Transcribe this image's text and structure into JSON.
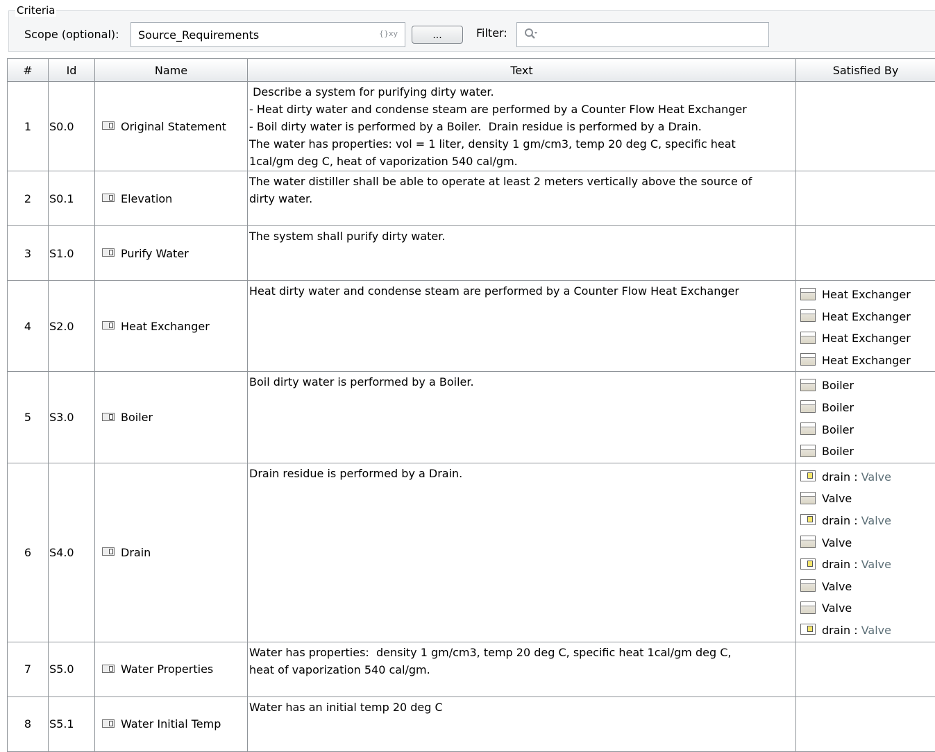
{
  "criteria": {
    "title": "Criteria",
    "scope_label": "Scope (optional):",
    "scope_value": "Source_Requirements",
    "scope_icon": "{}xy",
    "browse_label": "...",
    "filter_label": "Filter:"
  },
  "table": {
    "headers": {
      "num": "#",
      "id": "Id",
      "name": "Name",
      "text": "Text",
      "satisfied": "Satisfied By"
    },
    "rows": [
      {
        "num": "1",
        "id": "S0.0",
        "name": "Original Statement",
        "text_lines": [
          " Describe a system for purifying dirty water.",
          "- Heat dirty water and condense steam are performed by a Counter Flow Heat Exchanger",
          "- Boil dirty water is performed by a Boiler.  Drain residue is performed by a Drain.",
          "The water has properties: vol = 1 liter, density 1 gm/cm3, temp 20 deg C, specific heat",
          "1cal/gm deg C, heat of vaporization 540 cal/gm."
        ]
      },
      {
        "num": "2",
        "id": "S0.1",
        "name": "Elevation",
        "text_lines": [
          "The water distiller shall be able to operate at least 2 meters vertically above the source of",
          "dirty water."
        ]
      },
      {
        "num": "3",
        "id": "S1.0",
        "name": "Purify Water",
        "text_lines": [
          "The system shall purify dirty water."
        ]
      },
      {
        "num": "4",
        "id": "S2.0",
        "name": "Heat Exchanger",
        "text_lines": [
          "Heat dirty water and condense steam are performed by a Counter Flow Heat Exchanger"
        ],
        "satisfied": [
          "Heat Exchanger",
          "Heat Exchanger",
          "Heat Exchanger",
          "Heat Exchanger"
        ]
      },
      {
        "num": "5",
        "id": "S3.0",
        "name": "Boiler",
        "text_lines": [
          "Boil dirty water is performed by a Boiler."
        ],
        "satisfied": [
          "Boiler",
          "Boiler",
          "Boiler",
          "Boiler"
        ]
      },
      {
        "num": "6",
        "id": "S4.0",
        "name": "Drain",
        "text_lines": [
          "Drain residue is performed by a Drain."
        ],
        "satisfied_parts": {
          "part_name": "drain",
          "separator": " : ",
          "type_name": "Valve",
          "block_name": "Valve"
        }
      },
      {
        "num": "7",
        "id": "S5.0",
        "name": "Water Properties",
        "text_lines": [
          "Water has properties:  density 1 gm/cm3, temp 20 deg C, specific heat 1cal/gm deg C,",
          "heat of vaporization 540 cal/gm."
        ]
      },
      {
        "num": "8",
        "id": "S5.1",
        "name": "Water Initial Temp",
        "text_lines": [
          "Water has an initial temp 20 deg C"
        ]
      }
    ]
  },
  "icons": {
    "requirement": "requirement-icon",
    "block": "block-icon",
    "part": "part-property-icon",
    "search": "search-icon"
  }
}
